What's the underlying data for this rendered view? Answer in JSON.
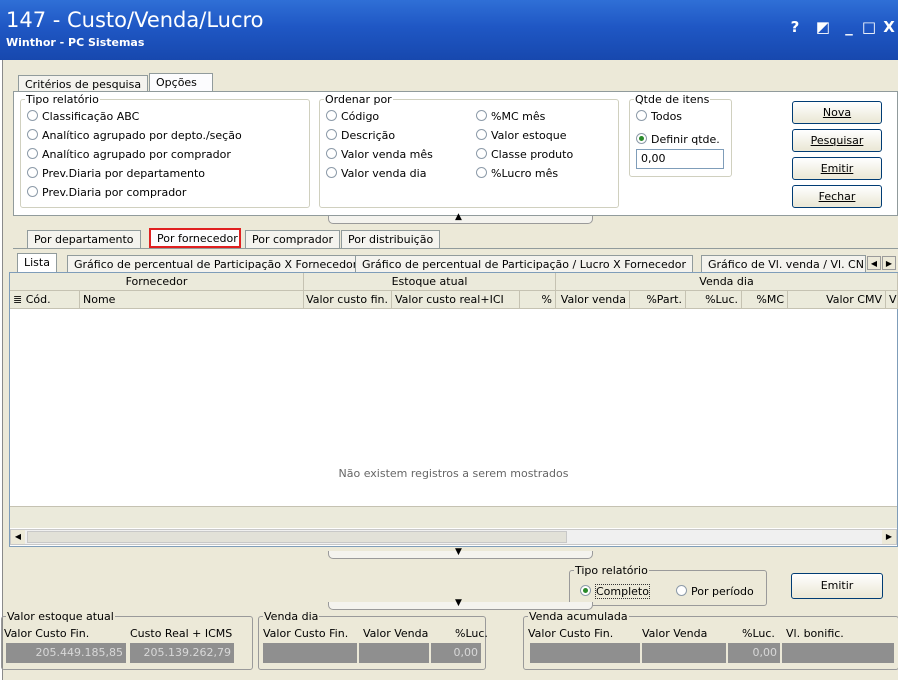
{
  "window": {
    "title": "147 - Custo/Venda/Lucro",
    "subtitle": "Winthor - PC Sistemas",
    "buttons": [
      "?",
      "◩",
      "_",
      "□",
      "X"
    ]
  },
  "top_tabs": [
    "Critérios de pesquisa",
    "Opções"
  ],
  "tipo_relatorio": {
    "legend": "Tipo relatório",
    "options": [
      "Classificação ABC",
      "Analítico agrupado por depto./seção",
      "Analítico agrupado por comprador",
      "Prev.Diaria por departamento",
      "Prev.Diaria por comprador"
    ]
  },
  "ordenar_por": {
    "legend": "Ordenar por",
    "col1": [
      "Código",
      "Descrição",
      "Valor venda mês",
      "Valor venda dia"
    ],
    "col2": [
      "%MC mês",
      "Valor estoque",
      "Classe produto",
      "%Lucro mês"
    ]
  },
  "qtde_itens": {
    "legend": "Qtde de itens",
    "options": [
      "Todos",
      "Definir qtde."
    ],
    "selected": "Definir qtde.",
    "value": "0,00"
  },
  "actions": [
    "Nova",
    "Pesquisar",
    "Emitir",
    "Fechar"
  ],
  "group_tabs": [
    "Por departamento",
    "Por fornecedor",
    "Por comprador",
    "Por distribuição"
  ],
  "sub_tabs": [
    "Lista",
    "Gráfico de percentual de Participação X Fornecedor",
    "Gráfico de percentual de Participação / Lucro X Fornecedor",
    "Gráfico de Vl. venda / Vl. CN"
  ],
  "grid": {
    "band_headers": [
      "Fornecedor",
      "Estoque atual",
      "Venda dia"
    ],
    "columns": [
      "Cód.",
      "Nome",
      "Valor custo fin.",
      "Valor custo real+ICI",
      "%",
      "Valor venda",
      "%Part.",
      "%Luc.",
      "%MC",
      "Valor CMV",
      "V"
    ],
    "empty_message": "Não existem registros a serem mostrados"
  },
  "tipo_relatorio_bottom": {
    "legend": "Tipo relatório",
    "options": [
      "Completo",
      "Por período"
    ],
    "selected": "Completo"
  },
  "emitir_bottom": "Emitir",
  "valor_estoque": {
    "legend": "Valor estoque  atual",
    "labels": [
      "Valor Custo Fin.",
      "Custo Real + ICMS"
    ],
    "values": [
      "205.449.185,85",
      "205.139.262,79"
    ]
  },
  "venda_dia": {
    "legend": "Venda dia",
    "labels": [
      "Valor Custo Fin.",
      "Valor Venda",
      "%Luc."
    ],
    "values": [
      "",
      "",
      "0,00"
    ]
  },
  "venda_acumulada": {
    "legend": "Venda acumulada",
    "labels": [
      "Valor Custo Fin.",
      "Valor Venda",
      "%Luc.",
      "Vl. bonific."
    ],
    "values": [
      "",
      "",
      "0,00",
      ""
    ]
  },
  "colors": {
    "title_bar": "#1f57c4",
    "highlight": "#e02020",
    "form_bg": "#ece9d8"
  }
}
